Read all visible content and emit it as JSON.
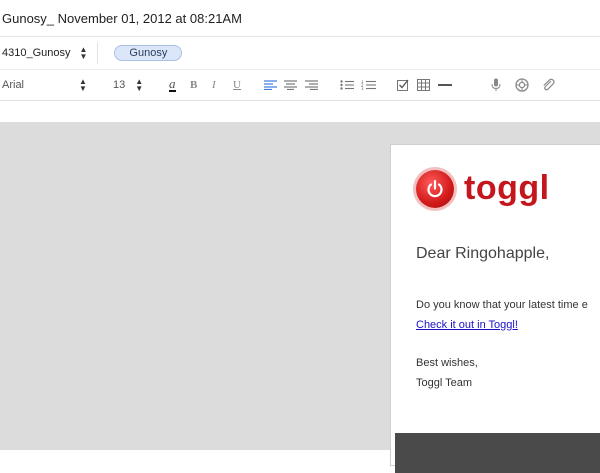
{
  "window": {
    "title": "Gunosy_ November 01, 2012 at 08:21AM"
  },
  "notebar": {
    "notebook": "4310_Gunosy",
    "tag": "Gunosy"
  },
  "format": {
    "font": "Arial",
    "size": "13",
    "icons": [
      "text-color-icon",
      "bold-icon",
      "italic-icon",
      "underline-icon",
      "align-left-icon",
      "align-center-icon",
      "align-right-icon",
      "bullet-list-icon",
      "numbered-list-icon",
      "checkbox-icon",
      "table-icon",
      "horizontal-rule-icon",
      "microphone-icon",
      "camera-icon",
      "attachment-icon"
    ],
    "glyphs": {
      "text_color": "a",
      "bold": "B",
      "italic": "I",
      "underline": "U"
    }
  },
  "email": {
    "brand": "toggl",
    "greeting": "Dear Ringohapple,",
    "body": "Do you know that your latest time e",
    "link": "Check it out in Toggl!",
    "sign1": "Best wishes,",
    "sign2": "Toggl Team"
  },
  "colors": {
    "brand_red": "#c4161c",
    "link": "#1a12c8",
    "tag_bg": "#dbe6f8"
  }
}
